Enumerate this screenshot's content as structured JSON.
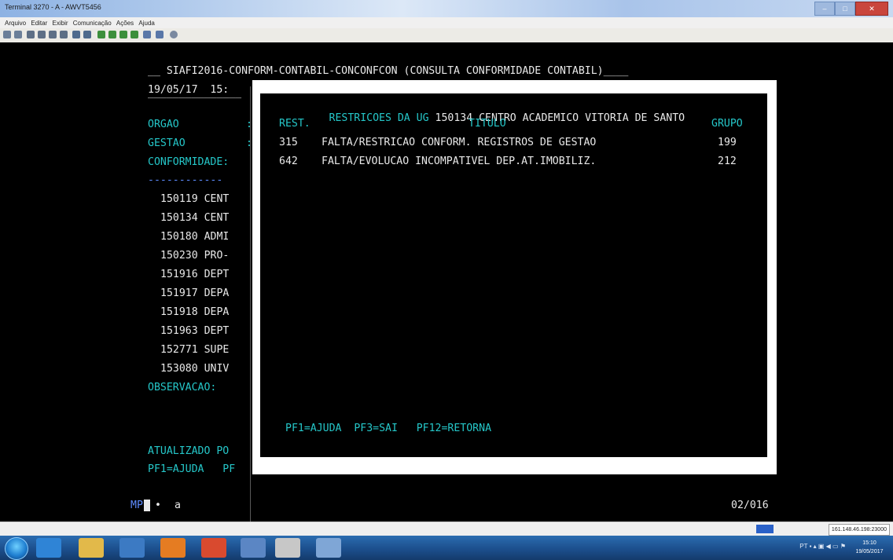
{
  "window": {
    "title": "Terminal 3270 - A - AWVT5456"
  },
  "menu": [
    "Arquivo",
    "Editar",
    "Exibir",
    "Comunicação",
    "Ações",
    "Ajuda"
  ],
  "screen": {
    "header": "SIAFI2016-CONFORM-CONTABIL-CONCONFCON (CONSULTA CONFORMIDADE CONTABIL)",
    "date": "19/05/17",
    "time": "15:",
    "orgao_label": "ORGAO",
    "gestao_label": "GESTAO",
    "conformidade_label": "CONFORMIDADE:",
    "dashes": "------------",
    "ug_rows": [
      "150119 CENT",
      "150134 CENT",
      "150180 ADMI",
      "150230 PRO-",
      "151916 DEPT",
      "151917 DEPA",
      "151918 DEPA",
      "151963 DEPT",
      "152771 SUPE",
      "153080 UNIV"
    ],
    "observacao_label": "OBSERVACAO:",
    "atualizado_label": "ATUALIZADO PO",
    "pf_footer": "PF1=AJUDA   PF",
    "status_left": "MP",
    "status_mark": "a",
    "page": "02/016"
  },
  "popup": {
    "title_prefix": "RESTRICOES DA UG ",
    "title_ug": "150134 CENTRO ACADEMICO VITORIA DE SANTO",
    "col_rest": "REST.",
    "col_titulo": "TITULO",
    "col_grupo": "GRUPO",
    "rows": [
      {
        "rest": "315",
        "titulo": "FALTA/RESTRICAO CONFORM. REGISTROS DE GESTAO",
        "grupo": "199"
      },
      {
        "rest": "642",
        "titulo": "FALTA/EVOLUCAO INCOMPATIVEL DEP.AT.IMOBILIZ.",
        "grupo": "212"
      }
    ],
    "footer": "PF1=AJUDA  PF3=SAI   PF12=RETORNA"
  },
  "statusbar": {
    "address": "161.148.46.198:23000"
  },
  "taskbar": {
    "clock_time": "15:10",
    "clock_date": "19/05/2017",
    "tray_text": "PT"
  },
  "colors": {
    "terminal_bg": "#000000",
    "terminal_text": "#e9e9e9",
    "field_label": "#25c7c9",
    "protected_data": "#2ee06a",
    "popup_border": "#ffffff"
  }
}
